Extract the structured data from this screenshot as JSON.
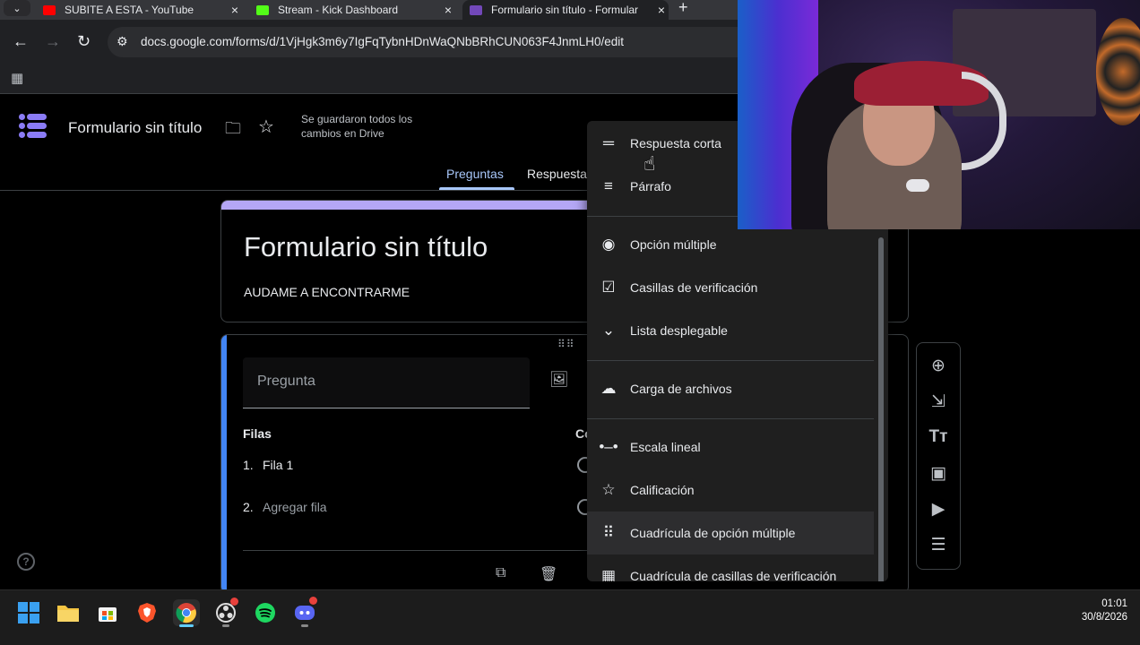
{
  "browser": {
    "tabs": [
      {
        "title": "SUBITE A ESTA - YouTube",
        "favicon": "youtube-icon",
        "active": false
      },
      {
        "title": "Stream - Kick Dashboard",
        "favicon": "kick-icon",
        "active": false
      },
      {
        "title": "Formulario sin título - Formular",
        "favicon": "google-forms-icon",
        "active": true
      }
    ],
    "url": "docs.google.com/forms/d/1VjHgk3m6y7IgFqTybnHDnWaQNbBRhCUN063F4JnmLH0/edit"
  },
  "forms_header": {
    "doc_title": "Formulario sin título",
    "save_status": "Se guardaron todos los cambios en Drive",
    "tabs": [
      "Preguntas",
      "Respuesta"
    ]
  },
  "form": {
    "title": "Formulario sin título",
    "description": "AUDAME A ENCONTRARME",
    "question": {
      "placeholder": "Pregunta",
      "rows_label": "Filas",
      "cols_label": "Co",
      "rows": [
        {
          "num": "1.",
          "text": "Fila 1"
        },
        {
          "num": "2.",
          "text": "Agregar fila"
        }
      ]
    }
  },
  "type_menu": {
    "items": [
      {
        "label": "Respuesta corta",
        "icon": "short-text-icon"
      },
      {
        "label": "Párrafo",
        "icon": "paragraph-icon"
      },
      {
        "label": "Opción múltiple",
        "icon": "radio-button-icon"
      },
      {
        "label": "Casillas de verificación",
        "icon": "checkbox-icon"
      },
      {
        "label": "Lista desplegable",
        "icon": "dropdown-icon"
      },
      {
        "label": "Carga de archivos",
        "icon": "cloud-upload-icon"
      },
      {
        "label": "Escala lineal",
        "icon": "linear-scale-icon"
      },
      {
        "label": "Calificación",
        "icon": "star-icon"
      },
      {
        "label": "Cuadrícula de opción múltiple",
        "icon": "grid-icon"
      },
      {
        "label": "Cuadrícula de casillas de verificación",
        "icon": "checkbox-grid-icon"
      }
    ],
    "highlighted": "Cuadrícula de opción múltiple"
  },
  "taskbar": {
    "time": "01:01",
    "date": "30/8/2026"
  },
  "colors": {
    "accent": "#a8c7fa",
    "forms_purple": "#8b7cf6",
    "question_bar": "#4285f4"
  }
}
